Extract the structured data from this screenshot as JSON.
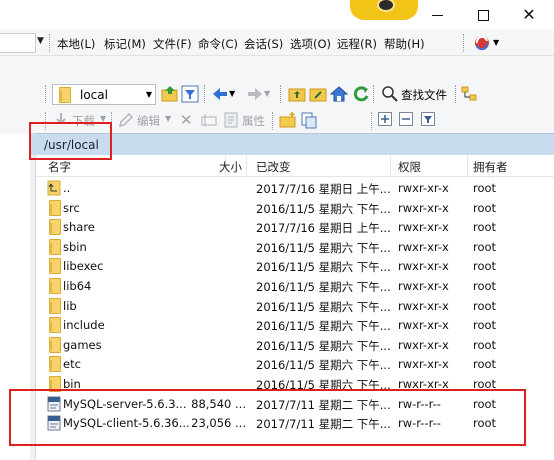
{
  "menu": {
    "items": [
      "本地(L)",
      "标记(M)",
      "文件(F)",
      "命令(C)",
      "会话(S)",
      "选项(O)",
      "远程(R)",
      "帮助(H)"
    ]
  },
  "toolbar": {
    "location": "local",
    "find_files": "查找文件",
    "download": "下载",
    "edit": "编辑",
    "properties": "属性"
  },
  "path": "/usr/local",
  "table": {
    "headers": {
      "name": "名字",
      "size": "大小",
      "modified": "已改变",
      "permissions": "权限",
      "owner": "拥有者"
    },
    "rows": [
      {
        "icon": "parent-dir-icon",
        "name": "..",
        "size": "",
        "modified": "2017/7/16 星期日 上午...",
        "permissions": "rwxr-xr-x",
        "owner": "root"
      },
      {
        "icon": "folder-icon",
        "name": "src",
        "size": "",
        "modified": "2016/11/5 星期六 下午...",
        "permissions": "rwxr-xr-x",
        "owner": "root"
      },
      {
        "icon": "folder-icon",
        "name": "share",
        "size": "",
        "modified": "2017/7/16 星期日 上午...",
        "permissions": "rwxr-xr-x",
        "owner": "root"
      },
      {
        "icon": "folder-icon",
        "name": "sbin",
        "size": "",
        "modified": "2016/11/5 星期六 下午...",
        "permissions": "rwxr-xr-x",
        "owner": "root"
      },
      {
        "icon": "folder-icon",
        "name": "libexec",
        "size": "",
        "modified": "2016/11/5 星期六 下午...",
        "permissions": "rwxr-xr-x",
        "owner": "root"
      },
      {
        "icon": "folder-icon",
        "name": "lib64",
        "size": "",
        "modified": "2016/11/5 星期六 下午...",
        "permissions": "rwxr-xr-x",
        "owner": "root"
      },
      {
        "icon": "folder-icon",
        "name": "lib",
        "size": "",
        "modified": "2016/11/5 星期六 下午...",
        "permissions": "rwxr-xr-x",
        "owner": "root"
      },
      {
        "icon": "folder-icon",
        "name": "include",
        "size": "",
        "modified": "2016/11/5 星期六 下午...",
        "permissions": "rwxr-xr-x",
        "owner": "root"
      },
      {
        "icon": "folder-icon",
        "name": "games",
        "size": "",
        "modified": "2016/11/5 星期六 下午...",
        "permissions": "rwxr-xr-x",
        "owner": "root"
      },
      {
        "icon": "folder-icon",
        "name": "etc",
        "size": "",
        "modified": "2016/11/5 星期六 下午...",
        "permissions": "rwxr-xr-x",
        "owner": "root"
      },
      {
        "icon": "folder-icon",
        "name": "bin",
        "size": "",
        "modified": "2016/11/5 星期六 下午...",
        "permissions": "rwxr-xr-x",
        "owner": "root"
      },
      {
        "icon": "rpm-file-icon",
        "name": "MySQL-server-5.6.3...",
        "size": "88,540 ...",
        "modified": "2017/7/11 星期二 下午...",
        "permissions": "rw-r--r--",
        "owner": "root"
      },
      {
        "icon": "rpm-file-icon",
        "name": "MySQL-client-5.6.36...",
        "size": "23,056 ...",
        "modified": "2017/7/11 星期二 下午...",
        "permissions": "rw-r--r--",
        "owner": "root"
      }
    ]
  }
}
